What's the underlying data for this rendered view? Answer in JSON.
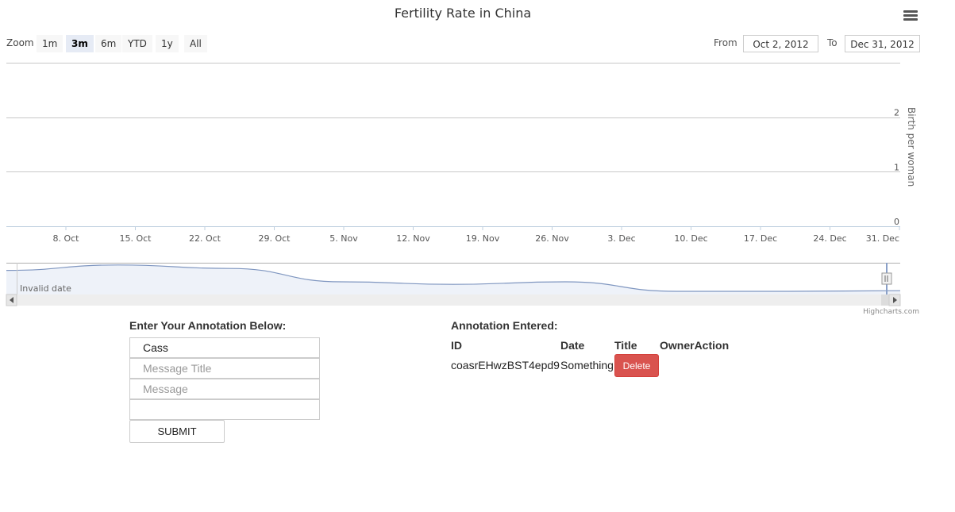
{
  "chart": {
    "title": "Fertility Rate in China",
    "menu_icon": "hamburger-menu-icon",
    "credits": "Highcharts.com"
  },
  "range_selector": {
    "zoom_label": "Zoom",
    "buttons": [
      "1m",
      "3m",
      "6m",
      "YTD",
      "1y",
      "All"
    ],
    "selected": "3m",
    "from_label": "From",
    "from_value": "Oct 2, 2012",
    "to_label": "To",
    "to_value": "Dec 31, 2012"
  },
  "navigator": {
    "label": "Invalid date"
  },
  "chart_data": {
    "type": "area",
    "title": "Fertility Rate in China",
    "ylabel": "Birth per woman",
    "ylim": [
      0,
      3
    ],
    "yticks": [
      0,
      1,
      2
    ],
    "xticks": [
      "8. Oct",
      "15. Oct",
      "22. Oct",
      "29. Oct",
      "5. Nov",
      "12. Nov",
      "19. Nov",
      "26. Nov",
      "3. Dec",
      "10. Dec",
      "17. Dec",
      "24. Dec",
      "31. Dec"
    ],
    "x_range": [
      "Oct 2, 2012",
      "Dec 31, 2012"
    ],
    "series": [],
    "navigator_series": {
      "values": [
        0.76,
        0.93,
        0.82,
        0.4,
        0.32,
        0.4,
        0.1,
        0.1,
        0.12
      ],
      "ylim": [
        0,
        1
      ]
    },
    "grid": true
  },
  "form": {
    "title": "Enter Your Annotation Below:",
    "name_value": "Cass",
    "title_placeholder": "Message Title",
    "message_placeholder": "Message",
    "extra_value": "",
    "submit_label": "SUBMIT"
  },
  "annotations": {
    "title": "Annotation Entered:",
    "headers": {
      "id": "ID",
      "date": "Date",
      "title": "Title",
      "owner_action": "OwnerAction"
    },
    "rows": [
      {
        "id": "coasrEHwzBST4epd9",
        "date": "Something",
        "delete_label": "Delete"
      }
    ]
  }
}
